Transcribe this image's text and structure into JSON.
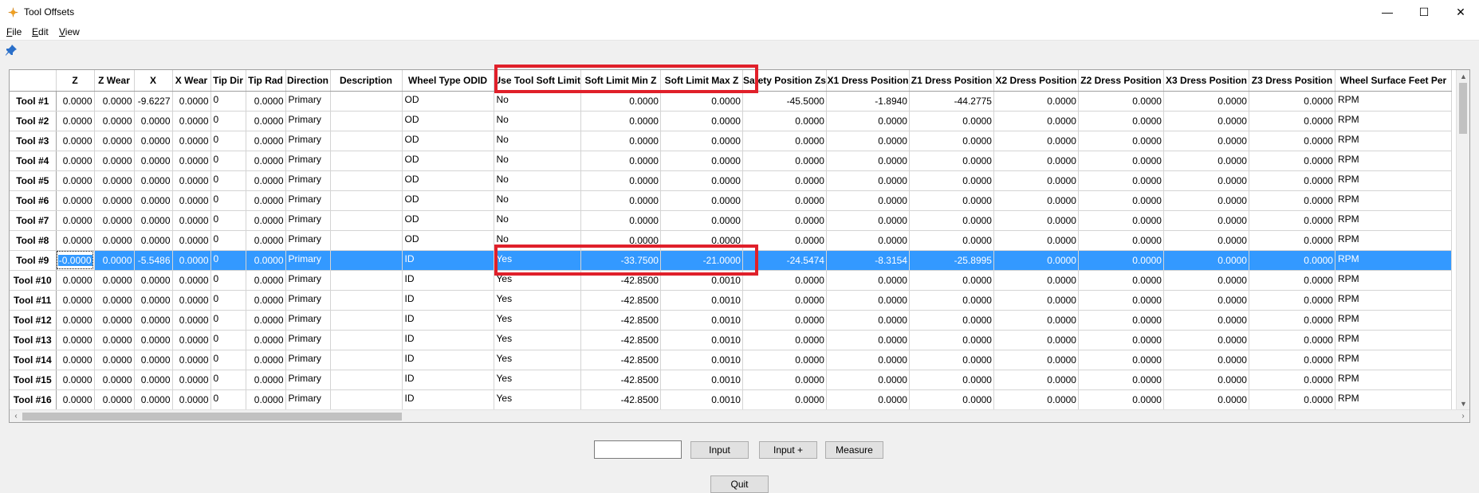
{
  "window": {
    "title": "Tool Offsets",
    "minimize": "—",
    "maximize": "☐",
    "close": "✕"
  },
  "menu": [
    {
      "accel": "F",
      "rest": "ile"
    },
    {
      "accel": "E",
      "rest": "dit"
    },
    {
      "accel": "V",
      "rest": "iew"
    }
  ],
  "grid": {
    "columns": [
      "Z",
      "Z Wear",
      "X",
      "X Wear",
      "Tip Dir",
      "Tip Rad",
      "Direction",
      "Description",
      "Wheel Type ODID",
      "Use Tool Soft Limit",
      "Soft Limit Min Z",
      "Soft Limit Max Z",
      "Safety Position Zs",
      "X1 Dress Position",
      "Z1 Dress Position",
      "X2 Dress Position",
      "Z2 Dress Position",
      "X3 Dress Position",
      "Z3 Dress Position",
      "Wheel Surface Feet Per"
    ],
    "rows": [
      {
        "name": "Tool #1",
        "cells": [
          "0.0000",
          "0.0000",
          "-9.6227",
          "0.0000",
          "0",
          "0.0000",
          "Primary",
          "",
          "OD",
          "No",
          "0.0000",
          "0.0000",
          "-45.5000",
          "-1.8940",
          "-44.2775",
          "0.0000",
          "0.0000",
          "0.0000",
          "0.0000",
          "RPM"
        ]
      },
      {
        "name": "Tool #2",
        "cells": [
          "0.0000",
          "0.0000",
          "0.0000",
          "0.0000",
          "0",
          "0.0000",
          "Primary",
          "",
          "OD",
          "No",
          "0.0000",
          "0.0000",
          "0.0000",
          "0.0000",
          "0.0000",
          "0.0000",
          "0.0000",
          "0.0000",
          "0.0000",
          "RPM"
        ]
      },
      {
        "name": "Tool #3",
        "cells": [
          "0.0000",
          "0.0000",
          "0.0000",
          "0.0000",
          "0",
          "0.0000",
          "Primary",
          "",
          "OD",
          "No",
          "0.0000",
          "0.0000",
          "0.0000",
          "0.0000",
          "0.0000",
          "0.0000",
          "0.0000",
          "0.0000",
          "0.0000",
          "RPM"
        ]
      },
      {
        "name": "Tool #4",
        "cells": [
          "0.0000",
          "0.0000",
          "0.0000",
          "0.0000",
          "0",
          "0.0000",
          "Primary",
          "",
          "OD",
          "No",
          "0.0000",
          "0.0000",
          "0.0000",
          "0.0000",
          "0.0000",
          "0.0000",
          "0.0000",
          "0.0000",
          "0.0000",
          "RPM"
        ]
      },
      {
        "name": "Tool #5",
        "cells": [
          "0.0000",
          "0.0000",
          "0.0000",
          "0.0000",
          "0",
          "0.0000",
          "Primary",
          "",
          "OD",
          "No",
          "0.0000",
          "0.0000",
          "0.0000",
          "0.0000",
          "0.0000",
          "0.0000",
          "0.0000",
          "0.0000",
          "0.0000",
          "RPM"
        ]
      },
      {
        "name": "Tool #6",
        "cells": [
          "0.0000",
          "0.0000",
          "0.0000",
          "0.0000",
          "0",
          "0.0000",
          "Primary",
          "",
          "OD",
          "No",
          "0.0000",
          "0.0000",
          "0.0000",
          "0.0000",
          "0.0000",
          "0.0000",
          "0.0000",
          "0.0000",
          "0.0000",
          "RPM"
        ]
      },
      {
        "name": "Tool #7",
        "cells": [
          "0.0000",
          "0.0000",
          "0.0000",
          "0.0000",
          "0",
          "0.0000",
          "Primary",
          "",
          "OD",
          "No",
          "0.0000",
          "0.0000",
          "0.0000",
          "0.0000",
          "0.0000",
          "0.0000",
          "0.0000",
          "0.0000",
          "0.0000",
          "RPM"
        ]
      },
      {
        "name": "Tool #8",
        "cells": [
          "0.0000",
          "0.0000",
          "0.0000",
          "0.0000",
          "0",
          "0.0000",
          "Primary",
          "",
          "OD",
          "No",
          "0.0000",
          "0.0000",
          "0.0000",
          "0.0000",
          "0.0000",
          "0.0000",
          "0.0000",
          "0.0000",
          "0.0000",
          "RPM"
        ]
      },
      {
        "name": "Tool #9",
        "selected": true,
        "cells": [
          "-0.0000",
          "0.0000",
          "-5.5486",
          "0.0000",
          "0",
          "0.0000",
          "Primary",
          "",
          "ID",
          "Yes",
          "-33.7500",
          "-21.0000",
          "-24.5474",
          "-8.3154",
          "-25.8995",
          "0.0000",
          "0.0000",
          "0.0000",
          "0.0000",
          "RPM"
        ]
      },
      {
        "name": "Tool #10",
        "cells": [
          "0.0000",
          "0.0000",
          "0.0000",
          "0.0000",
          "0",
          "0.0000",
          "Primary",
          "",
          "ID",
          "Yes",
          "-42.8500",
          "0.0010",
          "0.0000",
          "0.0000",
          "0.0000",
          "0.0000",
          "0.0000",
          "0.0000",
          "0.0000",
          "RPM"
        ]
      },
      {
        "name": "Tool #11",
        "cells": [
          "0.0000",
          "0.0000",
          "0.0000",
          "0.0000",
          "0",
          "0.0000",
          "Primary",
          "",
          "ID",
          "Yes",
          "-42.8500",
          "0.0010",
          "0.0000",
          "0.0000",
          "0.0000",
          "0.0000",
          "0.0000",
          "0.0000",
          "0.0000",
          "RPM"
        ]
      },
      {
        "name": "Tool #12",
        "cells": [
          "0.0000",
          "0.0000",
          "0.0000",
          "0.0000",
          "0",
          "0.0000",
          "Primary",
          "",
          "ID",
          "Yes",
          "-42.8500",
          "0.0010",
          "0.0000",
          "0.0000",
          "0.0000",
          "0.0000",
          "0.0000",
          "0.0000",
          "0.0000",
          "RPM"
        ]
      },
      {
        "name": "Tool #13",
        "cells": [
          "0.0000",
          "0.0000",
          "0.0000",
          "0.0000",
          "0",
          "0.0000",
          "Primary",
          "",
          "ID",
          "Yes",
          "-42.8500",
          "0.0010",
          "0.0000",
          "0.0000",
          "0.0000",
          "0.0000",
          "0.0000",
          "0.0000",
          "0.0000",
          "RPM"
        ]
      },
      {
        "name": "Tool #14",
        "cells": [
          "0.0000",
          "0.0000",
          "0.0000",
          "0.0000",
          "0",
          "0.0000",
          "Primary",
          "",
          "ID",
          "Yes",
          "-42.8500",
          "0.0010",
          "0.0000",
          "0.0000",
          "0.0000",
          "0.0000",
          "0.0000",
          "0.0000",
          "0.0000",
          "RPM"
        ]
      },
      {
        "name": "Tool #15",
        "cells": [
          "0.0000",
          "0.0000",
          "0.0000",
          "0.0000",
          "0",
          "0.0000",
          "Primary",
          "",
          "ID",
          "Yes",
          "-42.8500",
          "0.0010",
          "0.0000",
          "0.0000",
          "0.0000",
          "0.0000",
          "0.0000",
          "0.0000",
          "0.0000",
          "RPM"
        ]
      },
      {
        "name": "Tool #16",
        "cells": [
          "0.0000",
          "0.0000",
          "0.0000",
          "0.0000",
          "0",
          "0.0000",
          "Primary",
          "",
          "ID",
          "Yes",
          "-42.8500",
          "0.0010",
          "0.0000",
          "0.0000",
          "0.0000",
          "0.0000",
          "0.0000",
          "0.0000",
          "0.0000",
          "RPM"
        ]
      }
    ]
  },
  "bottom": {
    "input_value": "",
    "input_label": "Input",
    "input_plus_label": "Input +",
    "measure_label": "Measure",
    "quit_label": "Quit"
  },
  "colors": {
    "selection": "#3399ff",
    "highlight": "#e0202a"
  }
}
